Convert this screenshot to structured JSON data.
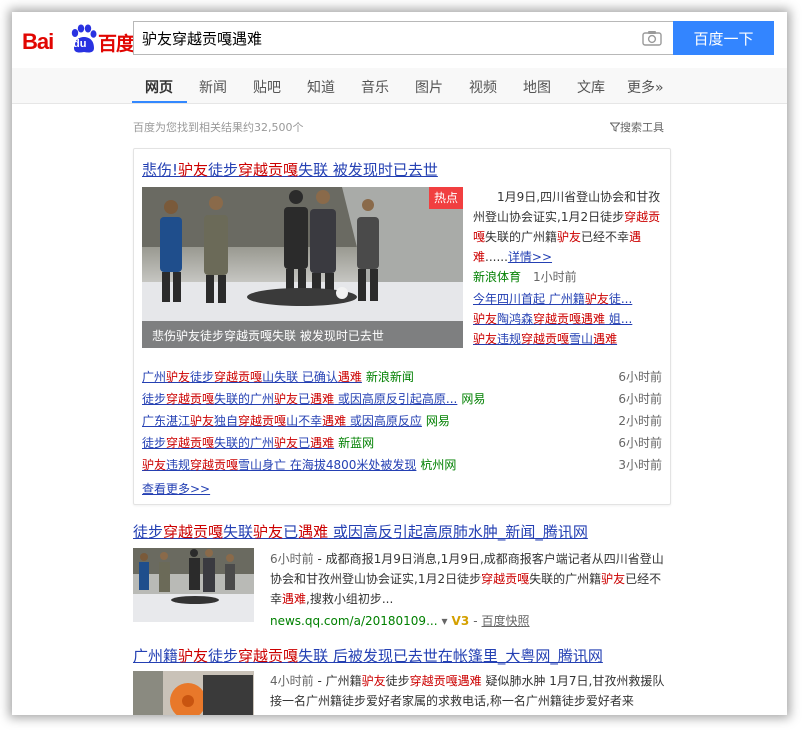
{
  "logo": {
    "bai": "Bai",
    "du": "du",
    "cn": "百度"
  },
  "search": {
    "query": "驴友穿越贡嘎遇难",
    "button": "百度一下"
  },
  "nav": {
    "items": [
      "网页",
      "新闻",
      "贴吧",
      "知道",
      "音乐",
      "图片",
      "视频",
      "地图",
      "文库",
      "更多»"
    ],
    "active": "网页"
  },
  "stats": {
    "count_text": "百度为您找到相关结果约32,500个",
    "tools": "搜索工具"
  },
  "news_card": {
    "title": [
      [
        "悲伤!",
        ""
      ],
      [
        "驴友",
        "em"
      ],
      [
        "徒步",
        ""
      ],
      [
        "穿越贡嘎",
        "em"
      ],
      [
        "失联 被发现时已去世",
        ""
      ]
    ],
    "image_caption": "悲伤驴友徒步穿越贡嘎失联 被发现时已去世",
    "hot_badge": "热点",
    "abstract": [
      [
        "1月9日,四川省登山协会和甘孜州登山协会证实,1月2日徒步",
        ""
      ],
      [
        "穿越贡嘎",
        "em"
      ],
      [
        "失联的广州籍",
        ""
      ],
      [
        "驴友",
        "em"
      ],
      [
        "已经不幸",
        ""
      ],
      [
        "遇难",
        "em"
      ],
      [
        "......",
        ""
      ]
    ],
    "abstract_more": "详情>>",
    "source": "新浪体育",
    "source_time": "1小时前",
    "related": [
      [
        [
          "今年四川首起 广州籍",
          ""
        ],
        [
          "驴友",
          "em"
        ],
        [
          "徒...",
          ""
        ]
      ],
      [
        [
          "驴友",
          "em"
        ],
        [
          "陶鸿森",
          ""
        ],
        [
          "穿越贡嘎遇难",
          "em"
        ],
        [
          " 姐...",
          ""
        ]
      ],
      [
        [
          "驴友",
          "em"
        ],
        [
          "违规",
          ""
        ],
        [
          "穿越贡嘎",
          "em"
        ],
        [
          "雪山",
          ""
        ],
        [
          "遇难",
          "em"
        ]
      ]
    ],
    "list": [
      {
        "parts": [
          [
            "广州",
            ""
          ],
          [
            "驴友",
            "em"
          ],
          [
            "徒步",
            ""
          ],
          [
            "穿越贡嘎",
            "em"
          ],
          [
            "山失联 已确认",
            ""
          ],
          [
            "遇难",
            "em"
          ]
        ],
        "source": "新浪新闻",
        "time": "6小时前"
      },
      {
        "parts": [
          [
            "徒步",
            ""
          ],
          [
            "穿越贡嘎",
            "em"
          ],
          [
            "失联的广州",
            ""
          ],
          [
            "驴友",
            "em"
          ],
          [
            "已",
            ""
          ],
          [
            "遇难",
            "em"
          ],
          [
            " 或因高原反引起高原...",
            ""
          ]
        ],
        "source": "网易",
        "time": "6小时前"
      },
      {
        "parts": [
          [
            "广东湛江",
            ""
          ],
          [
            "驴友",
            "em"
          ],
          [
            "独自",
            ""
          ],
          [
            "穿越贡嘎",
            "em"
          ],
          [
            "山不幸",
            ""
          ],
          [
            "遇难",
            "em"
          ],
          [
            " 或因高原反应",
            ""
          ]
        ],
        "source": "网易",
        "time": "2小时前"
      },
      {
        "parts": [
          [
            "徒步",
            ""
          ],
          [
            "穿越贡嘎",
            "em"
          ],
          [
            "失联的广州",
            ""
          ],
          [
            "驴友",
            "em"
          ],
          [
            "已",
            ""
          ],
          [
            "遇难",
            "em"
          ]
        ],
        "source": "新蓝网",
        "time": "6小时前"
      },
      {
        "parts": [
          [
            "驴友",
            "em"
          ],
          [
            "违规",
            ""
          ],
          [
            "穿越贡嘎",
            "em"
          ],
          [
            "雪山身亡 在海拔4800米处被发现",
            ""
          ]
        ],
        "source": "杭州网",
        "time": "3小时前"
      }
    ],
    "see_more": "查看更多>>"
  },
  "results": [
    {
      "title": [
        [
          "徒步",
          ""
        ],
        [
          "穿越贡嘎",
          "em"
        ],
        [
          "失联",
          ""
        ],
        [
          "驴友",
          "em"
        ],
        [
          "已",
          ""
        ],
        [
          "遇难",
          "em"
        ],
        [
          " 或因高反引起高原肺水肿_新闻_腾讯网",
          ""
        ]
      ],
      "time": "6小时前",
      "abstract": [
        [
          " - 成都商报1月9日消息,1月9日,成都商报客户端记者从四川省登山协会和甘孜州登山协会证实,1月2日徒步",
          ""
        ],
        [
          "穿越贡嘎",
          "em"
        ],
        [
          "失联的广州籍",
          ""
        ],
        [
          "驴友",
          "em"
        ],
        [
          "已经不幸",
          ""
        ],
        [
          "遇难",
          "em"
        ],
        [
          ",搜救小组初步...",
          ""
        ]
      ],
      "url": "news.qq.com/a/20180109...",
      "v": "V3",
      "snapshot": "百度快照"
    },
    {
      "title": [
        [
          "广州籍",
          ""
        ],
        [
          "驴友",
          "em"
        ],
        [
          "徒步",
          ""
        ],
        [
          "穿越贡嘎",
          "em"
        ],
        [
          "失联 后被发现已去世在帐篷里_大粤网_腾讯网",
          ""
        ]
      ],
      "time": "4小时前",
      "abstract": [
        [
          " - 广州籍",
          ""
        ],
        [
          "驴友",
          "em"
        ],
        [
          "徒步",
          ""
        ],
        [
          "穿越贡嘎遇难",
          "em"
        ],
        [
          " 疑似肺水肿 1月7日,甘孜州救援队接一名广州籍徒步爱好者家属的求救电话,称一名广州籍徒步爱好者来",
          ""
        ]
      ]
    }
  ]
}
